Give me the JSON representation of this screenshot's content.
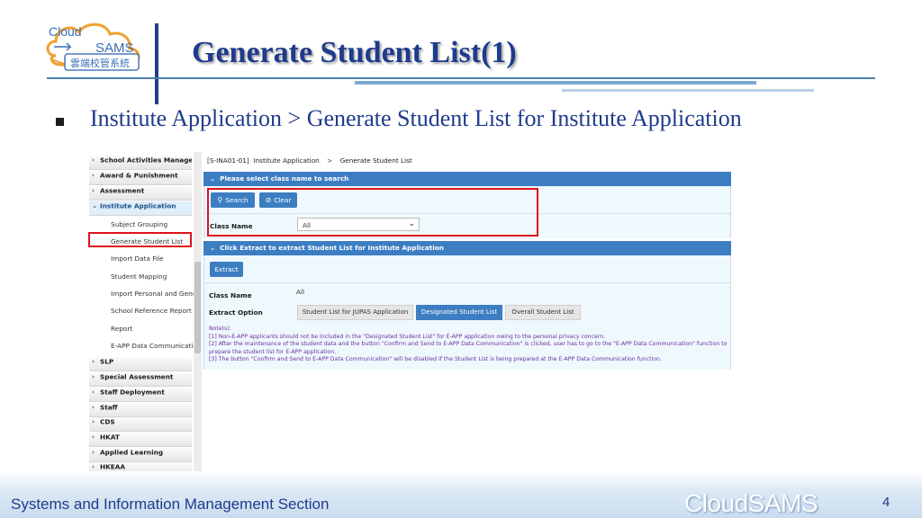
{
  "slide": {
    "title": "Generate Student List(1)",
    "bullet": "Institute Application > Generate Student List for Institute Application",
    "footer_text": "Systems and Information Management Section",
    "footer_brand": "CloudSAMS",
    "page_number": "4"
  },
  "logo": {
    "cloud": "Cloud",
    "sams": "SAMS",
    "chinese": "雲端校管系統"
  },
  "colors": {
    "title": "#1f3b8c",
    "panel_header": "#3d7ec2",
    "highlight_border": "#e0121c",
    "note_text": "#7030a0"
  },
  "sidebar": {
    "items": [
      {
        "label": "School Activities Management",
        "icon": "chevron-right-icon"
      },
      {
        "label": "Award & Punishment",
        "icon": "chevron-right-icon"
      },
      {
        "label": "Assessment",
        "icon": "chevron-right-icon"
      },
      {
        "label": "Institute Application",
        "icon": "chevron-down-icon"
      }
    ],
    "subitems": [
      "Subject Grouping",
      "Generate Student List",
      "Import Data File",
      "Student Mapping",
      "Import Personal and General Information",
      "School Reference Report",
      "Report",
      "E-APP Data Communication"
    ],
    "items_after": [
      "SLP",
      "Special Assessment",
      "Staff Deployment",
      "Staff",
      "CDS",
      "HKAT",
      "Applied Learning",
      "HKEAA"
    ]
  },
  "breadcrumb": {
    "code": "[S-INA01-01]",
    "module": "Institute Application",
    "separator": ">",
    "page": "Generate Student List"
  },
  "search_panel": {
    "header": "Please select class name to search",
    "search_button": "Search",
    "clear_button": "Clear",
    "class_name_label": "Class Name",
    "class_name_value": "All"
  },
  "extract_panel": {
    "header": "Click Extract to extract Student List for Institute Application",
    "extract_button": "Extract",
    "class_name_label": "Class Name",
    "class_name_value": "All",
    "extract_option_label": "Extract Option",
    "options": [
      {
        "label": "Student List for JUPAS Application",
        "selected": false
      },
      {
        "label": "Designated Student List",
        "selected": true
      },
      {
        "label": "Overall Student List",
        "selected": false
      }
    ],
    "notes": [
      "Note(s):",
      "[1]  Non-E-APP applicants should not be included in the \"Designated Student List\" for E-APP application owing to the personal privacy concern.",
      "[2]  After the maintenance of the student data and the button \"Confirm and Send to E-APP Data Communication\" is clicked, user has to go to the \"E-APP Data Communication\" function to prepare the student list for E-APP application.",
      "[3]  The button \"Confirm and Send to E-APP Data Communication\" will be disabled if the Student List is being prepared at the E-APP Data Communication function."
    ]
  }
}
